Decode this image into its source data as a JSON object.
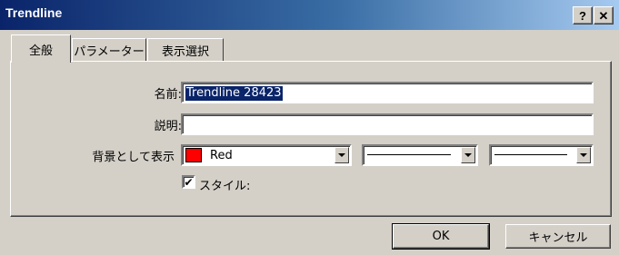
{
  "window": {
    "title": "Trendline"
  },
  "titlebar_buttons": {
    "help": "?",
    "close": "✕"
  },
  "tabs": [
    {
      "label": "全般"
    },
    {
      "label": "パラメーター"
    },
    {
      "label": "表示選択"
    }
  ],
  "form": {
    "name_label": "名前:",
    "name_value": "Trendline 28423",
    "desc_label": "説明:",
    "desc_value": "",
    "background_label": "背景として表示",
    "color_value": "Red",
    "color_hex": "#ff0000",
    "style_checkbox_label": "スタイル:",
    "style_checked": true,
    "check_glyph": "✔"
  },
  "buttons": {
    "ok": "OK",
    "cancel": "キャンセル"
  }
}
